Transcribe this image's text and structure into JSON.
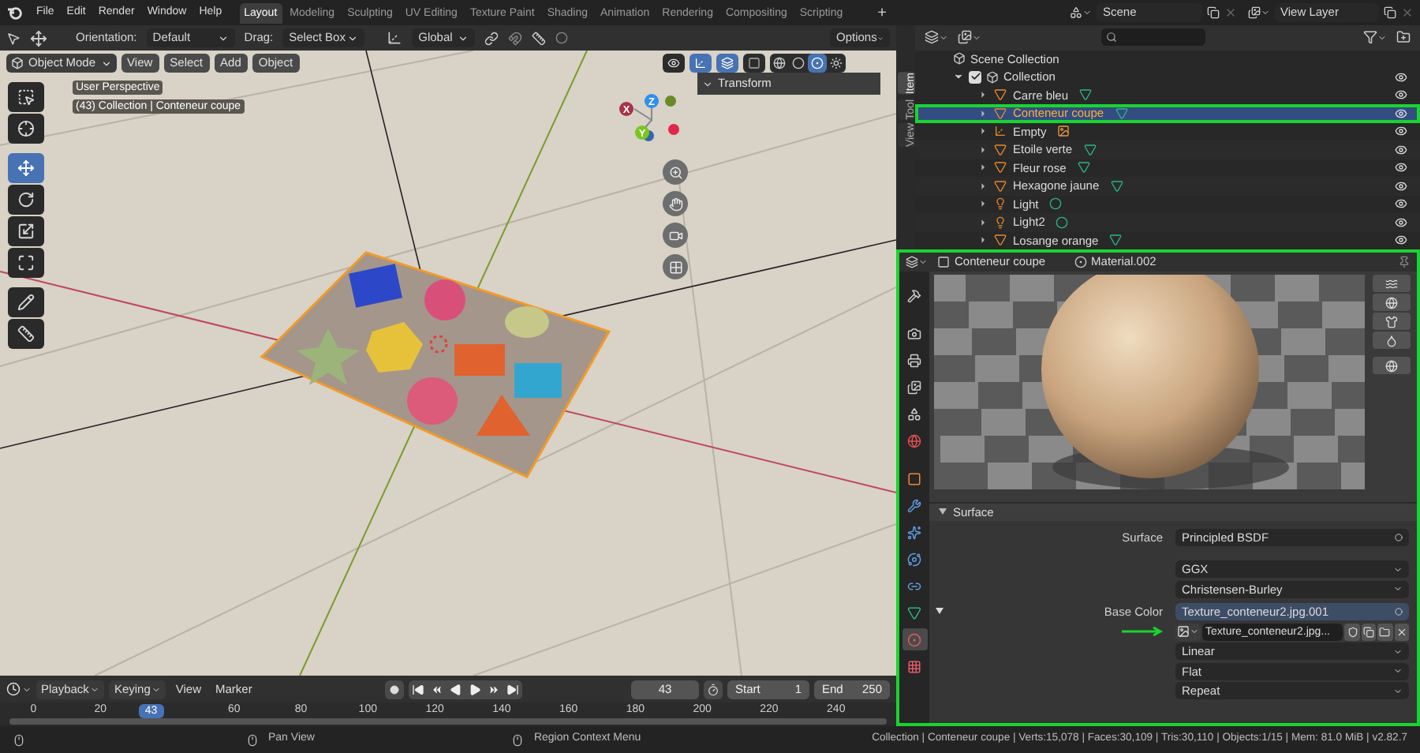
{
  "menu": [
    "File",
    "Edit",
    "Render",
    "Window",
    "Help"
  ],
  "workspaces": [
    {
      "label": "Layout",
      "selected": true
    },
    {
      "label": "Modeling",
      "selected": false
    },
    {
      "label": "Sculpting",
      "selected": false
    },
    {
      "label": "UV Editing",
      "selected": false
    },
    {
      "label": "Texture Paint",
      "selected": false
    },
    {
      "label": "Shading",
      "selected": false
    },
    {
      "label": "Animation",
      "selected": false
    },
    {
      "label": "Rendering",
      "selected": false
    },
    {
      "label": "Compositing",
      "selected": false
    },
    {
      "label": "Scripting",
      "selected": false
    }
  ],
  "add_workspace": "+",
  "scene_selector": {
    "scene": "Scene",
    "view_layer": "View Layer"
  },
  "tool_header": {
    "orientation_label": "Orientation:",
    "orientation": "Default",
    "drag_label": "Drag:",
    "drag": "Select Box",
    "transform": "Global",
    "options": "Options"
  },
  "viewport": {
    "mode": "Object Mode",
    "menus": [
      "View",
      "Select",
      "Add",
      "Object"
    ],
    "overlay_lines": [
      "User Perspective",
      "(43) Collection | Conteneur coupe"
    ],
    "tools": [
      {
        "kind": "select",
        "selected": false
      },
      {
        "kind": "cursor",
        "selected": false
      },
      {
        "kind": "move",
        "selected": true
      },
      {
        "kind": "rotate",
        "selected": false
      },
      {
        "kind": "scale",
        "selected": false
      },
      {
        "kind": "transform",
        "selected": false
      },
      {
        "kind": "annotate",
        "selected": false
      },
      {
        "kind": "measure",
        "selected": false
      }
    ],
    "shading_modes": [
      {
        "kind": "wireframe",
        "selected": false
      },
      {
        "kind": "solid",
        "selected": false
      },
      {
        "kind": "material",
        "selected": true
      },
      {
        "kind": "rendered",
        "selected": false
      }
    ],
    "gizmo_axes": [
      {
        "label": "X",
        "color": "#a8324a"
      },
      {
        "label": "Z",
        "color": "#2f8ef0"
      },
      {
        "label": "Y",
        "color": "#7cc51f"
      }
    ],
    "sidebar_panel": "Transform",
    "sidebar_tabs": [
      {
        "label": "Item",
        "selected": true
      },
      {
        "label": "Tool",
        "selected": false
      },
      {
        "label": "View",
        "selected": false
      }
    ]
  },
  "outliner": {
    "root": "Scene Collection",
    "collections": [
      {
        "label": "Collection",
        "checked": true,
        "expanded": true,
        "visible": true,
        "children": [
          {
            "label": "Carre bleu",
            "kind": "mesh",
            "expanded": false,
            "selected": false,
            "visible": true,
            "annotated": false
          },
          {
            "label": "Conteneur coupe",
            "kind": "mesh",
            "expanded": false,
            "selected": true,
            "visible": true,
            "annotated": true
          },
          {
            "label": "Empty",
            "kind": "empty",
            "expanded": false,
            "selected": false,
            "visible": true,
            "annotated": false
          },
          {
            "label": "Etoile verte",
            "kind": "mesh",
            "expanded": false,
            "selected": false,
            "visible": true,
            "annotated": false
          },
          {
            "label": "Fleur rose",
            "kind": "mesh",
            "expanded": false,
            "selected": false,
            "visible": true,
            "annotated": false
          },
          {
            "label": "Hexagone jaune",
            "kind": "mesh",
            "expanded": false,
            "selected": false,
            "visible": true,
            "annotated": false
          },
          {
            "label": "Light",
            "kind": "light",
            "expanded": false,
            "selected": false,
            "visible": true,
            "annotated": false
          },
          {
            "label": "Light2",
            "kind": "light",
            "expanded": false,
            "selected": false,
            "visible": true,
            "annotated": false
          },
          {
            "label": "Losange orange",
            "kind": "mesh",
            "expanded": false,
            "selected": false,
            "visible": true,
            "annotated": false
          }
        ]
      }
    ]
  },
  "properties": {
    "annotated": true,
    "object": "Conteneur coupe",
    "material": "Material.002",
    "tabs": [
      {
        "kind": "tool",
        "selected": false
      },
      {
        "kind": "render",
        "selected": false
      },
      {
        "kind": "output",
        "selected": false
      },
      {
        "kind": "view_layer",
        "selected": false
      },
      {
        "kind": "scene",
        "selected": false
      },
      {
        "kind": "world",
        "selected": false
      },
      {
        "kind": "object",
        "selected": false
      },
      {
        "kind": "modifier",
        "selected": false
      },
      {
        "kind": "particles",
        "selected": false
      },
      {
        "kind": "physics",
        "selected": false
      },
      {
        "kind": "constraints",
        "selected": false
      },
      {
        "kind": "data",
        "selected": false
      },
      {
        "kind": "material",
        "selected": true
      },
      {
        "kind": "texture",
        "selected": false
      }
    ],
    "panel": {
      "title": "Surface",
      "expanded": true
    },
    "fields": [
      {
        "kind": "link",
        "label": "Surface",
        "value": "Principled BSDF",
        "highlighted": false
      },
      {
        "kind": "dropdown",
        "value": "GGX"
      },
      {
        "kind": "dropdown",
        "value": "Christensen-Burley"
      },
      {
        "kind": "link",
        "label": "Base Color",
        "value": "Texture_conteneur2.jpg.001",
        "highlighted": true,
        "expanded": true
      },
      {
        "kind": "image",
        "value": "Texture_conteneur2.jpg...",
        "arrow": true
      },
      {
        "kind": "dropdown",
        "value": "Linear"
      },
      {
        "kind": "dropdown",
        "value": "Flat"
      },
      {
        "kind": "dropdown",
        "value": "Repeat"
      }
    ]
  },
  "timeline": {
    "menus": [
      "Playback",
      "Keying",
      "View",
      "Marker"
    ],
    "current_frame": "43",
    "marker_frame": "43",
    "start_label": "Start",
    "start": "1",
    "end_label": "End",
    "end": "250",
    "ticks": [
      "0",
      "20",
      "60",
      "80",
      "100",
      "120",
      "140",
      "160",
      "180",
      "200",
      "220",
      "240"
    ]
  },
  "status_bar": {
    "hints": [
      "Pan View",
      "Region Context Menu"
    ],
    "stats": "Collection | Conteneur coupe | Verts:15,078 | Faces:30,109 | Tris:30,110 | Objects:1/15 | Mem: 81.0 MiB | v2.82.7"
  }
}
